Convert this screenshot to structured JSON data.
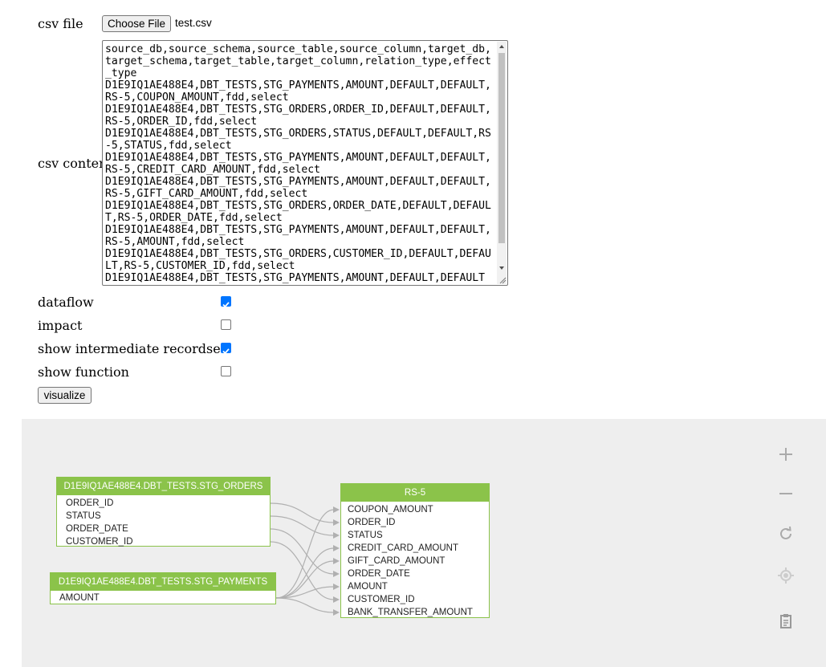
{
  "form": {
    "csv_file_label": "csv file",
    "choose_file_label": "Choose File",
    "file_name": "test.csv",
    "csv_content_label": "csv content",
    "csv_content": "source_db,source_schema,source_table,source_column,target_db,target_schema,target_table,target_column,relation_type,effect_type\nD1E9IQ1AE488E4,DBT_TESTS,STG_PAYMENTS,AMOUNT,DEFAULT,DEFAULT,RS-5,COUPON_AMOUNT,fdd,select\nD1E9IQ1AE488E4,DBT_TESTS,STG_ORDERS,ORDER_ID,DEFAULT,DEFAULT,RS-5,ORDER_ID,fdd,select\nD1E9IQ1AE488E4,DBT_TESTS,STG_ORDERS,STATUS,DEFAULT,DEFAULT,RS-5,STATUS,fdd,select\nD1E9IQ1AE488E4,DBT_TESTS,STG_PAYMENTS,AMOUNT,DEFAULT,DEFAULT,RS-5,CREDIT_CARD_AMOUNT,fdd,select\nD1E9IQ1AE488E4,DBT_TESTS,STG_PAYMENTS,AMOUNT,DEFAULT,DEFAULT,RS-5,GIFT_CARD_AMOUNT,fdd,select\nD1E9IQ1AE488E4,DBT_TESTS,STG_ORDERS,ORDER_DATE,DEFAULT,DEFAULT,RS-5,ORDER_DATE,fdd,select\nD1E9IQ1AE488E4,DBT_TESTS,STG_PAYMENTS,AMOUNT,DEFAULT,DEFAULT,RS-5,AMOUNT,fdd,select\nD1E9IQ1AE488E4,DBT_TESTS,STG_ORDERS,CUSTOMER_ID,DEFAULT,DEFAULT,RS-5,CUSTOMER_ID,fdd,select\nD1E9IQ1AE488E4,DBT_TESTS,STG_PAYMENTS,AMOUNT,DEFAULT,DEFAULT",
    "options": [
      {
        "label": "dataflow",
        "checked": true
      },
      {
        "label": "impact",
        "checked": false
      },
      {
        "label": "show intermediate recordset",
        "checked": true
      },
      {
        "label": "show function",
        "checked": false
      }
    ],
    "visualize_label": "visualize"
  },
  "graph": {
    "nodes": [
      {
        "id": "orders",
        "title": "D1E9IQ1AE488E4.DBT_TESTS.STG_ORDERS",
        "columns": [
          "ORDER_ID",
          "STATUS",
          "ORDER_DATE",
          "CUSTOMER_ID"
        ]
      },
      {
        "id": "payments",
        "title": "D1E9IQ1AE488E4.DBT_TESTS.STG_PAYMENTS",
        "columns": [
          "AMOUNT"
        ]
      },
      {
        "id": "rs5",
        "title": "RS-5",
        "columns": [
          "COUPON_AMOUNT",
          "ORDER_ID",
          "STATUS",
          "CREDIT_CARD_AMOUNT",
          "GIFT_CARD_AMOUNT",
          "ORDER_DATE",
          "AMOUNT",
          "CUSTOMER_ID",
          "BANK_TRANSFER_AMOUNT"
        ]
      }
    ],
    "edges": [
      {
        "from": "orders.ORDER_ID",
        "to": "rs5.ORDER_ID"
      },
      {
        "from": "orders.STATUS",
        "to": "rs5.STATUS"
      },
      {
        "from": "orders.ORDER_DATE",
        "to": "rs5.ORDER_DATE"
      },
      {
        "from": "orders.CUSTOMER_ID",
        "to": "rs5.CUSTOMER_ID"
      },
      {
        "from": "payments.AMOUNT",
        "to": "rs5.COUPON_AMOUNT"
      },
      {
        "from": "payments.AMOUNT",
        "to": "rs5.CREDIT_CARD_AMOUNT"
      },
      {
        "from": "payments.AMOUNT",
        "to": "rs5.GIFT_CARD_AMOUNT"
      },
      {
        "from": "payments.AMOUNT",
        "to": "rs5.AMOUNT"
      },
      {
        "from": "payments.AMOUNT",
        "to": "rs5.BANK_TRANSFER_AMOUNT"
      }
    ],
    "edge_color": "#b0b0b0",
    "node_color": "#8bc34a",
    "controls": [
      "zoom-in-icon",
      "zoom-out-icon",
      "refresh-icon",
      "locate-icon",
      "clipboard-icon"
    ]
  }
}
